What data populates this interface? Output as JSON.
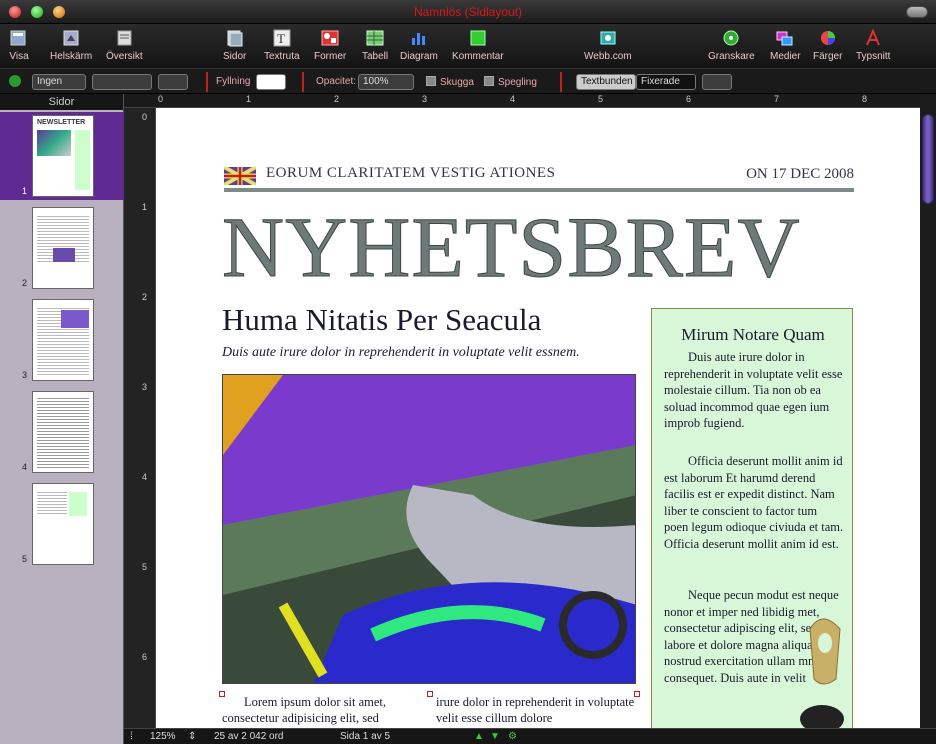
{
  "window": {
    "title": "Namnlös (Sidlayout)"
  },
  "toolbar": {
    "buttons": [
      {
        "label": "Visa",
        "icon": "view-icon"
      },
      {
        "label": "Helskärm",
        "icon": "fullscreen-icon"
      },
      {
        "label": "Översikt",
        "icon": "inspector-icon"
      },
      {
        "label": "Sidor",
        "icon": "pages-icon"
      },
      {
        "label": "Textruta",
        "icon": "textbox-icon"
      },
      {
        "label": "Former",
        "icon": "shapes-icon"
      },
      {
        "label": "Tabell",
        "icon": "table-icon"
      },
      {
        "label": "Diagram",
        "icon": "chart-icon"
      },
      {
        "label": "Kommentar",
        "icon": "comment-icon"
      },
      {
        "label": "Webb.com",
        "icon": "share-icon"
      },
      {
        "label": "Granskare",
        "icon": "inspector-wheel-icon"
      },
      {
        "label": "Medier",
        "icon": "media-icon"
      },
      {
        "label": "Färger",
        "icon": "colors-icon"
      },
      {
        "label": "Typsnitt",
        "icon": "fonts-icon"
      }
    ]
  },
  "formatbar": {
    "shape_style": "Ingen",
    "fill_label": "Fyllning",
    "opacity_label": "Opacitet:",
    "opacity_value": "100%",
    "shadow_label": "Skugga",
    "reflection_label": "Spegling",
    "wrap_inline": "Textbunden",
    "wrap_fixed": "Fixerade"
  },
  "sidebar": {
    "title": "Sidor",
    "pages": [
      "1",
      "2",
      "3",
      "4",
      "5"
    ],
    "selected": 0
  },
  "ruler": {
    "top_ticks": [
      "0",
      "1",
      "2",
      "3",
      "4",
      "5",
      "6",
      "7",
      "8"
    ],
    "left_ticks": [
      "0",
      "1",
      "2",
      "3",
      "4",
      "5",
      "6"
    ]
  },
  "statusbar": {
    "zoom": "125%",
    "word_count": "25 av 2 042 ord",
    "page_indicator": "Sida 1 av 5"
  },
  "document": {
    "kicker": "EORUM CLARITATEM VESTIG ATIONES",
    "date": "ON 17 DEC 2008",
    "title": "NYHETSBREV",
    "headline": "Huma Nitatis Per Seacula",
    "subhead": "Duis aute irure dolor in reprehenderit in voluptate velit essnem.",
    "sidebar_box": {
      "title": "Mirum Notare Quam",
      "paragraphs": [
        "Duis aute irure dolor in reprehenderit in voluptate velit esse molestaie cillum. Tia non ob ea soluad incommod quae egen ium improb fugiend.",
        "Officia deserunt mollit anim id est laborum Et harumd derend facilis est er expedit distinct. Nam liber te conscient to factor tum poen legum odioque civiuda et tam. Officia deserunt mollit anim id est.",
        "Neque pecun modut est neque nonor et imper ned libidig met, consectetur adipiscing elit, sed ut labore et dolore magna aliquam is nostrud exercitation ullam mmodo consequet. Duis aute in velit"
      ]
    },
    "col1": "Lorem ipsum dolor sit amet, consectetur adipisicing elit, sed",
    "col2": "irure dolor in reprehenderit in voluptate velit esse cillum dolore"
  }
}
